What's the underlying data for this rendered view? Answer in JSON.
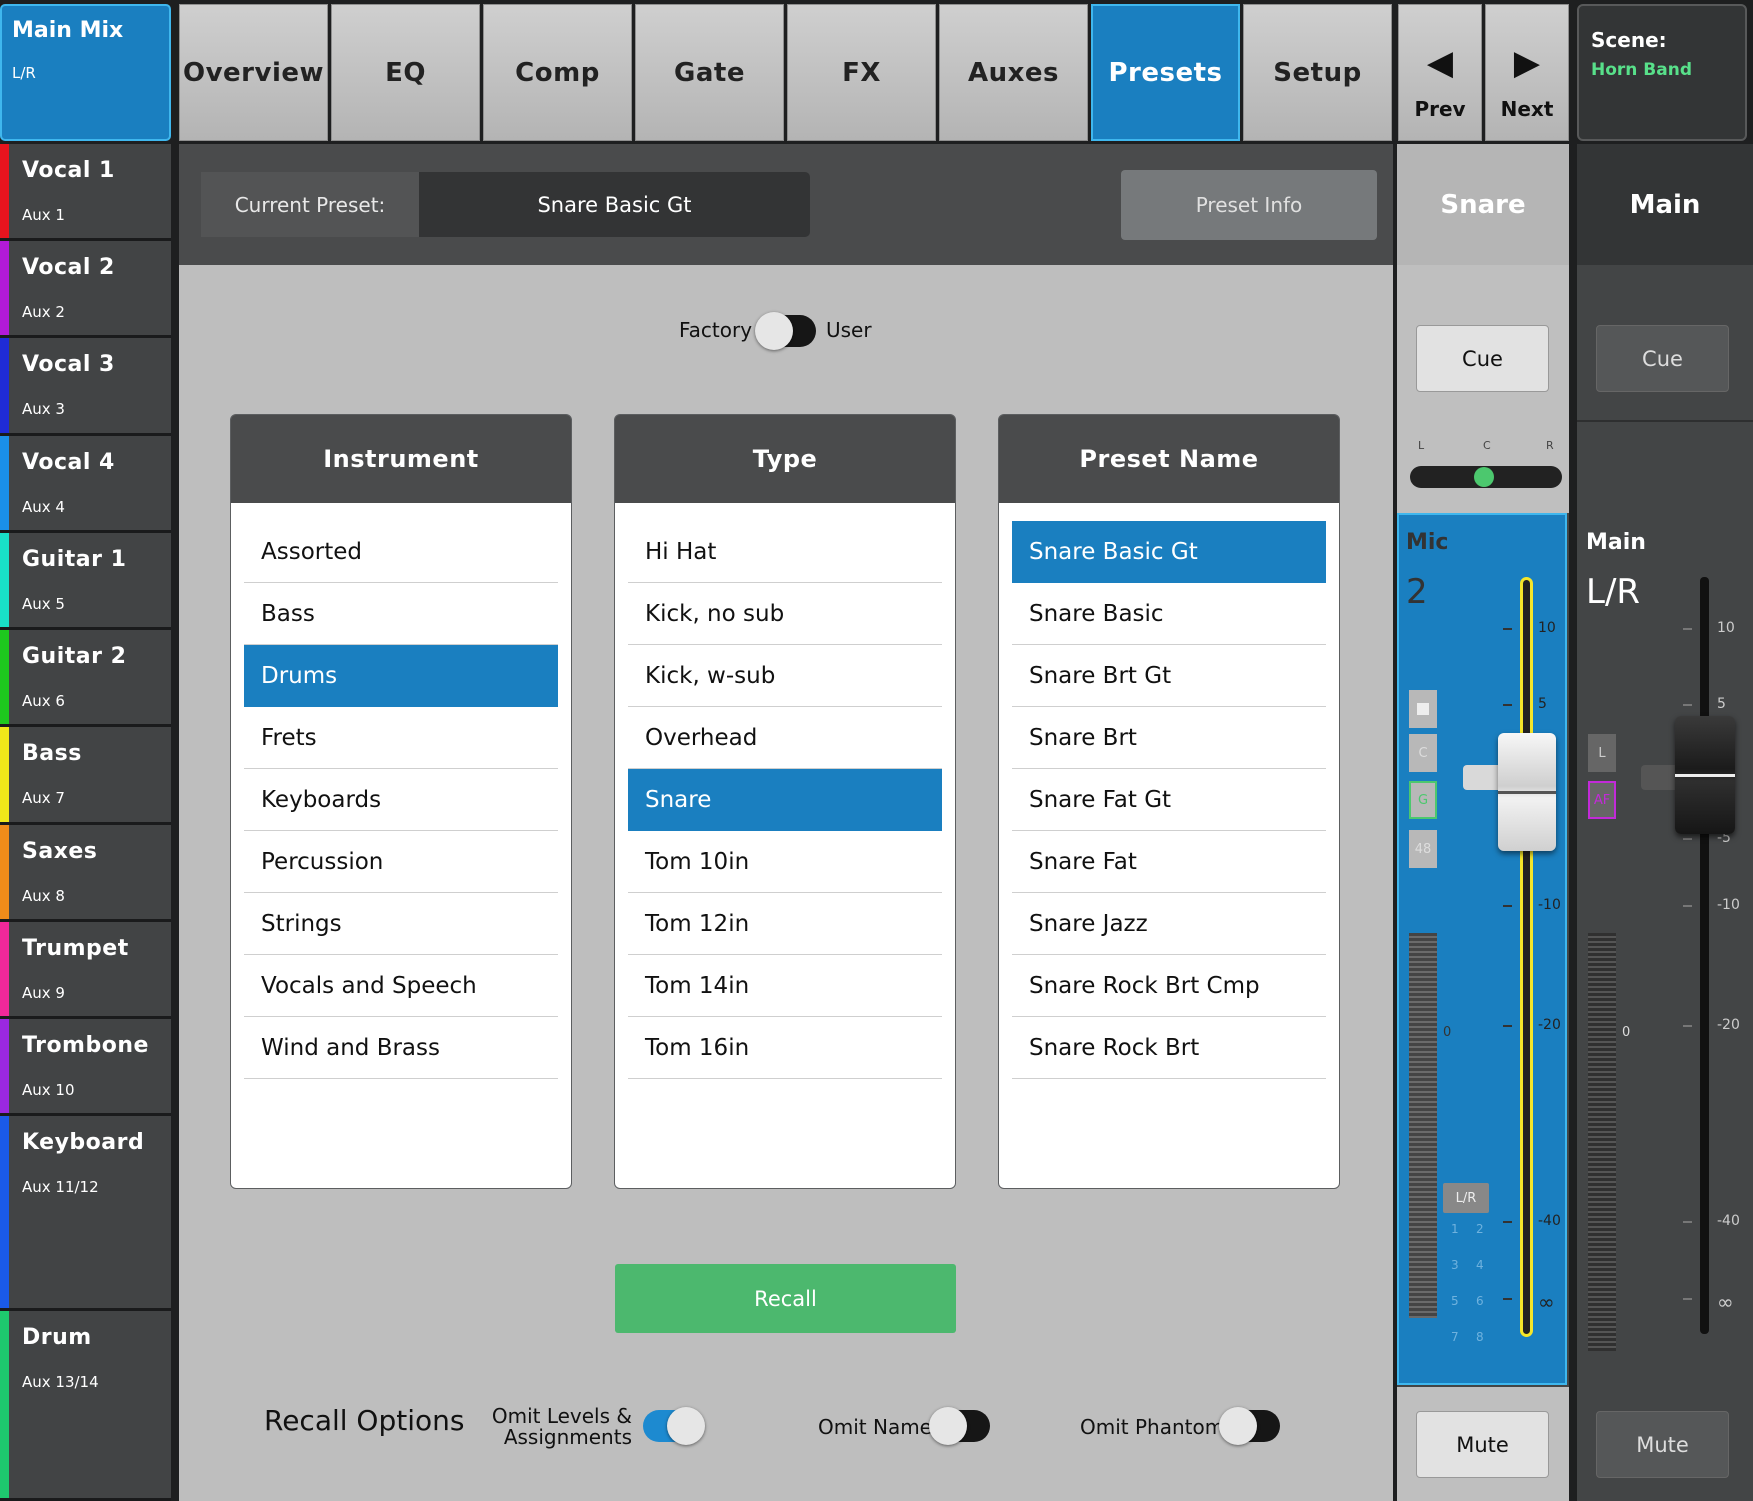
{
  "sidebar": {
    "main_mix": {
      "title": "Main Mix",
      "sub": "L/R"
    },
    "channels": [
      {
        "name": "Vocal 1",
        "aux": "Aux 1",
        "color": "#e8141e"
      },
      {
        "name": "Vocal 2",
        "aux": "Aux 2",
        "color": "#b21ad8"
      },
      {
        "name": "Vocal 3",
        "aux": "Aux 3",
        "color": "#1f2bd6"
      },
      {
        "name": "Vocal 4",
        "aux": "Aux 4",
        "color": "#1a8fe8"
      },
      {
        "name": "Guitar 1",
        "aux": "Aux 5",
        "color": "#19e0c8"
      },
      {
        "name": "Guitar 2",
        "aux": "Aux 6",
        "color": "#1ec81e"
      },
      {
        "name": "Bass",
        "aux": "Aux 7",
        "color": "#f0e81a"
      },
      {
        "name": "Saxes",
        "aux": "Aux 8",
        "color": "#f08c1a"
      },
      {
        "name": "Trumpet",
        "aux": "Aux 9",
        "color": "#f0289a"
      },
      {
        "name": "Trombone",
        "aux": "Aux 10",
        "color": "#9a28e0"
      },
      {
        "name": "Keyboard",
        "aux": "Aux 11/12",
        "color": "#1a5ae8"
      },
      {
        "name": "Drum",
        "aux": "Aux 13/14",
        "color": "#1ec86e"
      }
    ]
  },
  "tabs": [
    "Overview",
    "EQ",
    "Comp",
    "Gate",
    "FX",
    "Auxes",
    "Presets",
    "Setup"
  ],
  "active_tab": "Presets",
  "nav": {
    "prev": "Prev",
    "next": "Next"
  },
  "scene": {
    "label": "Scene:",
    "name": "Horn Band"
  },
  "current_preset": {
    "label": "Current Preset:",
    "value": "Snare Basic Gt"
  },
  "preset_info": "Preset Info",
  "source_toggle": {
    "left": "Factory",
    "right": "User"
  },
  "lists": {
    "instrument": {
      "header": "Instrument",
      "items": [
        "Assorted",
        "Bass",
        "Drums",
        "Frets",
        "Keyboards",
        "Percussion",
        "Strings",
        "Vocals and Speech",
        "Wind and Brass"
      ],
      "selected": 2
    },
    "type": {
      "header": "Type",
      "items": [
        "Hi Hat",
        "Kick, no sub",
        "Kick, w-sub",
        "Overhead",
        "Snare",
        "Tom 10in",
        "Tom 12in",
        "Tom 14in",
        "Tom 16in"
      ],
      "selected": 4
    },
    "preset_name": {
      "header": "Preset Name",
      "items": [
        "Snare Basic Gt",
        "Snare Basic",
        "Snare Brt Gt",
        "Snare Brt",
        "Snare Fat Gt",
        "Snare Fat",
        "Snare Jazz",
        "Snare Rock Brt Cmp",
        "Snare Rock Brt"
      ],
      "selected": 0
    }
  },
  "recall": "Recall",
  "recall_options": {
    "title": "Recall Options",
    "omit_levels": "Omit Levels &\nAssignments",
    "omit_name": "Omit Name",
    "omit_phantom": "Omit Phantom"
  },
  "strip_channel": {
    "name": "Snare",
    "cue": "Cue",
    "pan": [
      "L",
      "C",
      "R"
    ],
    "input_type": "Mic",
    "input_num": "2",
    "buttons": [
      "C",
      "G",
      "48"
    ],
    "assign": "L/R",
    "assign_nums": [
      "1",
      "2",
      "3",
      "4",
      "5",
      "6",
      "7",
      "8"
    ],
    "meter_zero": "0",
    "scale": [
      "10",
      "5",
      "-10",
      "-20",
      "-40",
      "∞"
    ],
    "mute": "Mute"
  },
  "strip_main": {
    "name": "Main",
    "cue": "Cue",
    "label": "Main",
    "sub": "L/R",
    "buttons": [
      "L",
      "AF"
    ],
    "meter_zero": "0",
    "scale": [
      "10",
      "5",
      "-5",
      "-10",
      "-20",
      "-40",
      "∞"
    ],
    "mute": "Mute"
  }
}
